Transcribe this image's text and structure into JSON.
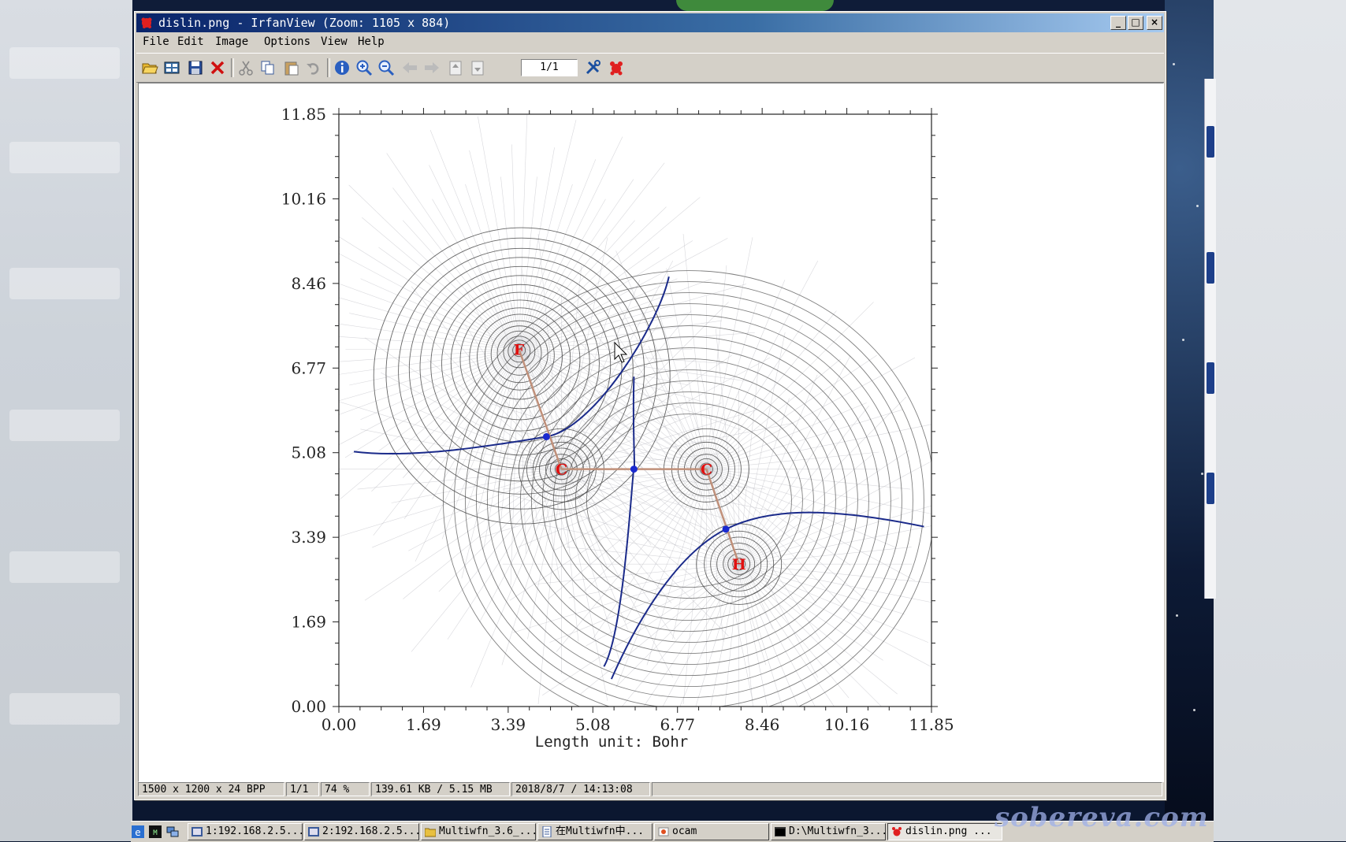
{
  "window": {
    "title": "dislin.png - IrfanView (Zoom: 1105 x 884)",
    "controls": {
      "minimize": "_",
      "maximize": "□",
      "close": "×"
    }
  },
  "menu": [
    "File",
    "Edit",
    "Image",
    "Options",
    "View",
    "Help"
  ],
  "toolbar": {
    "icons": [
      "open-icon",
      "thumbnails-icon",
      "save-icon",
      "delete-icon",
      "cut-icon",
      "copy-icon",
      "paste-icon",
      "undo-icon",
      "info-icon",
      "zoom-in-icon",
      "zoom-out-icon",
      "prev-icon",
      "next-icon",
      "first-page-icon",
      "last-page-icon",
      "settings-icon",
      "irfanview-icon"
    ],
    "page_field": "1/1"
  },
  "plot": {
    "xlabel": "Length unit: Bohr",
    "x_ticks": [
      "0.00",
      "1.69",
      "3.39",
      "5.08",
      "6.77",
      "8.46",
      "10.16",
      "11.85"
    ],
    "y_ticks": [
      "11.85",
      "10.16",
      "8.46",
      "6.77",
      "5.08",
      "3.39",
      "1.69",
      "0.00"
    ],
    "atoms": [
      {
        "label": "F",
        "x": 3.6,
        "y": 7.15
      },
      {
        "label": "C",
        "x": 4.45,
        "y": 4.75
      },
      {
        "label": "C",
        "x": 7.35,
        "y": 4.75
      },
      {
        "label": "H",
        "x": 8.0,
        "y": 2.85
      }
    ],
    "colors": {
      "contour": "#4a4a4a",
      "gradient": "#b8b8c0",
      "basin": "#1a2a8a",
      "bond": "#c0907a",
      "atom": "#e01010"
    }
  },
  "status": [
    "1500 x 1200 x 24 BPP",
    "1/1",
    "74 %",
    "139.61 KB / 5.15 MB",
    "2018/8/7 / 14:13:08"
  ],
  "taskbar": {
    "items": [
      "1:192.168.2.5...",
      "2:192.168.2.5...",
      "Multiwfn_3.6_...",
      "在Multiwfn中...",
      "ocam",
      "D:\\Multiwfn_3...",
      "dislin.png ..."
    ]
  },
  "watermark": "sobereva.com"
}
